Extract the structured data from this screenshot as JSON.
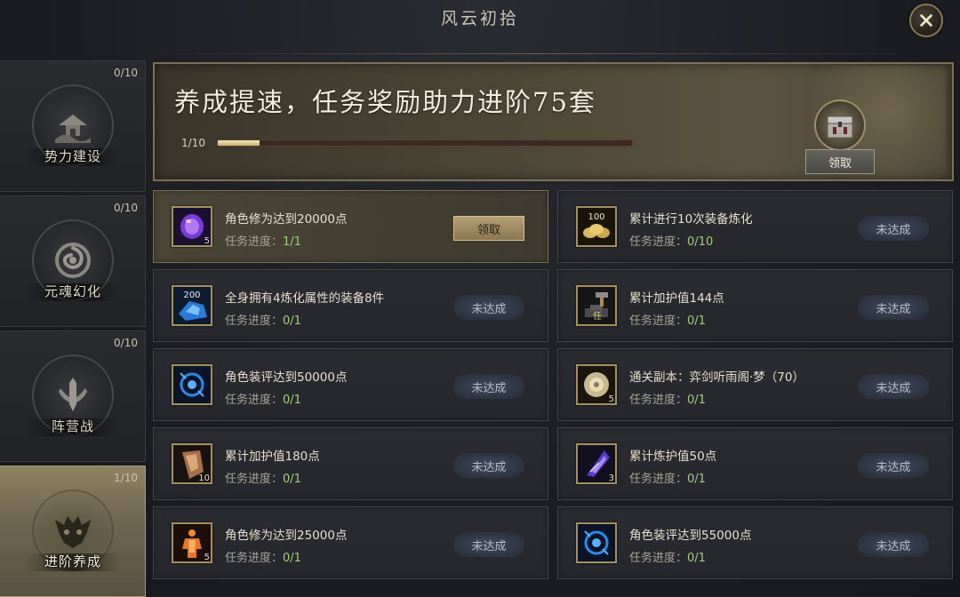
{
  "header": {
    "title": "风云初拾"
  },
  "sidebar": {
    "tabs": [
      {
        "label": "势力建设",
        "count": "0/10",
        "active": false
      },
      {
        "label": "元魂幻化",
        "count": "0/10",
        "active": false
      },
      {
        "label": "阵营战",
        "count": "0/10",
        "active": false
      },
      {
        "label": "进阶养成",
        "count": "1/10",
        "active": true
      }
    ]
  },
  "banner": {
    "title": "养成提速，任务奖励助力进阶75套",
    "progress_text": "1/10",
    "progress_fraction": 0.1,
    "claim_label": "领取"
  },
  "tasks": {
    "progress_prefix": "任务进度：",
    "left": [
      {
        "name": "角色修为达到20000点",
        "progress": "1/1",
        "button": "领取",
        "done": true,
        "icon": "purple-gem-icon",
        "icon_count": "5"
      },
      {
        "name": "全身拥有4炼化属性的装备8件",
        "progress": "0/1",
        "button": "未达成",
        "done": false,
        "icon": "blue-crystal-200-icon",
        "icon_count": ""
      },
      {
        "name": "角色装评达到50000点",
        "progress": "0/1",
        "button": "未达成",
        "done": false,
        "icon": "blue-orb-icon",
        "icon_count": ""
      },
      {
        "name": "累计加护值180点",
        "progress": "0/1",
        "button": "未达成",
        "done": false,
        "icon": "bronze-shard-icon",
        "icon_count": "10"
      },
      {
        "name": "角色修为达到25000点",
        "progress": "0/1",
        "button": "未达成",
        "done": false,
        "icon": "orange-figure-icon",
        "icon_count": "5"
      }
    ],
    "right": [
      {
        "name": "累计进行10次装备炼化",
        "progress": "0/10",
        "button": "未达成",
        "done": false,
        "icon": "gold-coin-100-icon",
        "icon_count": ""
      },
      {
        "name": "累计加护值144点",
        "progress": "0/1",
        "button": "未达成",
        "done": false,
        "icon": "hammer-anvil-icon",
        "icon_count": ""
      },
      {
        "name": "通关副本：弈剑听雨阁·梦（70）",
        "progress": "0/1",
        "button": "未达成",
        "done": false,
        "icon": "scroll-disc-icon",
        "icon_count": "5"
      },
      {
        "name": "累计炼护值50点",
        "progress": "0/1",
        "button": "未达成",
        "done": false,
        "icon": "purple-feather-icon",
        "icon_count": "3"
      },
      {
        "name": "角色装评达到55000点",
        "progress": "0/1",
        "button": "未达成",
        "done": false,
        "icon": "blue-orb-icon",
        "icon_count": ""
      }
    ]
  },
  "colors": {
    "accent_gold": "#b3a076",
    "progress_done": "#9ecf7a",
    "active_tab": "#8e8464"
  }
}
